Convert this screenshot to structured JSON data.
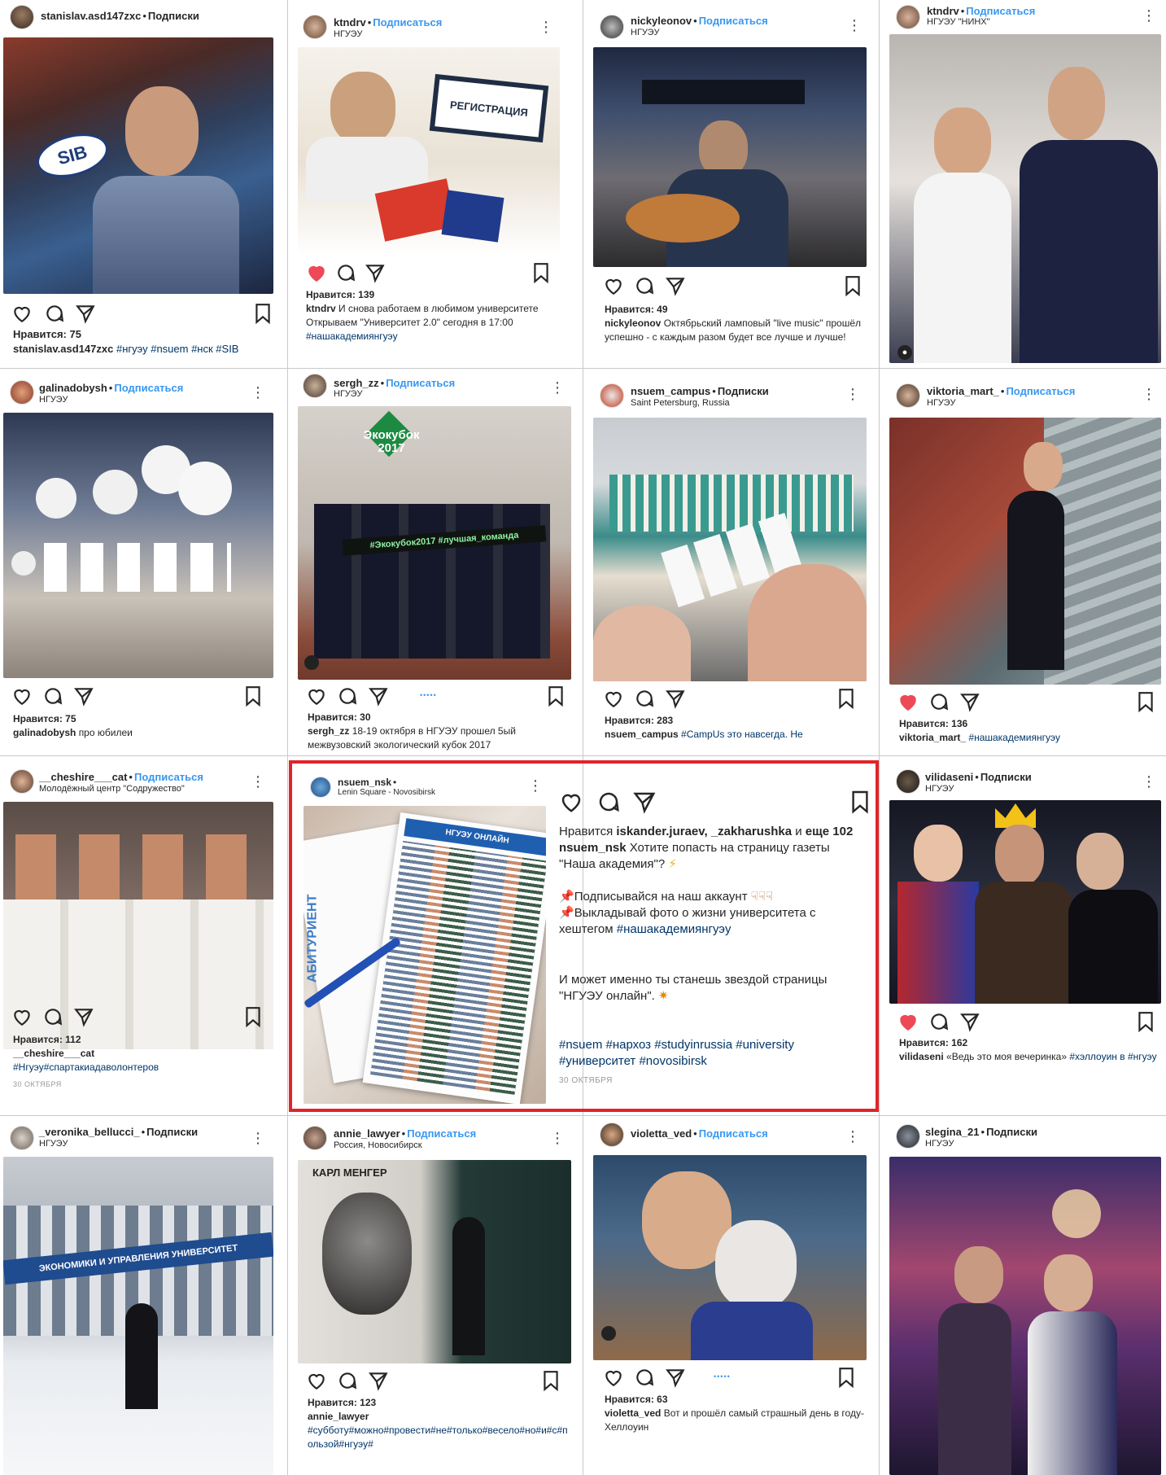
{
  "colors": {
    "accent": "#3897f0",
    "like_red": "#ed4956",
    "highlight_border": "#e0242a",
    "hashtag": "#003569"
  },
  "icons": [
    "heart-icon",
    "comment-icon",
    "share-icon",
    "bookmark-icon",
    "more-icon",
    "user-tag-icon"
  ],
  "posts": [
    {
      "user": "stanislav.asd147zxc",
      "sep": "•",
      "status": "Подписки",
      "location": "",
      "likes": "Нравится: 75",
      "caption_user": "stanislav.asd147zxc",
      "caption": "#нгуэу #nsuem #нск #SIB",
      "liked": false
    },
    {
      "user": "ktndrv",
      "sep": "•",
      "status": "Подписаться",
      "location": "НГУЭУ",
      "likes": "Нравится: 139",
      "caption_user": "ktndrv",
      "caption": "И снова работаем в любимом университете",
      "caption2": "Открываем \"Университет 2.0\" сегодня в 17:00",
      "caption3": "#нашакадемиянгуэу",
      "liked": true
    },
    {
      "user": "nickyleonov",
      "sep": "•",
      "status": "Подписаться",
      "location": "НГУЭУ",
      "likes": "Нравится: 49",
      "caption_user": "nickyleonov",
      "caption": "Октябрьский ламповый \"live music\" прошёл успешно - с каждым разом будет все лучше и лучше!",
      "liked": false
    },
    {
      "user": "ktndrv",
      "sep": "•",
      "status": "Подписаться",
      "location": "НГУЭУ \"НИНХ\"",
      "liked": false
    },
    {
      "user": "galinadobysh",
      "sep": "•",
      "status": "Подписаться",
      "location": "НГУЭУ",
      "likes": "Нравится: 75",
      "caption_user": "galinadobysh",
      "caption": "про юбилеи",
      "liked": false
    },
    {
      "user": "sergh_zz",
      "sep": "•",
      "status": "Подписаться",
      "location": "НГУЭУ",
      "likes": "Нравится: 30",
      "caption_user": "sergh_zz",
      "caption": "18-19 октября в НГУЭУ прошел 5ый межвузовский экологический кубок 2017",
      "dots": "•••••",
      "liked": false
    },
    {
      "user": "nsuem_campus",
      "sep": "•",
      "status": "Подписки",
      "location": "Saint Petersburg, Russia",
      "likes": "Нравится: 283",
      "caption_user": "nsuem_campus",
      "caption": "#CampUs это навсегда. Не",
      "liked": false
    },
    {
      "user": "viktoria_mart_",
      "sep": "•",
      "status": "Подписаться",
      "location": "НГУЭУ",
      "likes": "Нравится: 136",
      "caption_user": "viktoria_mart_",
      "caption": "#нашакадемиянгуэу",
      "liked": true
    },
    {
      "user": "__cheshire___cat",
      "sep": "•",
      "status": "Подписаться",
      "location": "Молодёжный центр \"Содружество\"",
      "likes": "Нравится: 112",
      "caption_user": "__cheshire___cat",
      "caption": "#Нгуэу#спартакиадаволонтеров",
      "date": "30 ОКТЯБРЯ",
      "liked": false
    },
    {
      "user": "vilidaseni",
      "sep": "•",
      "status": "Подписки",
      "location": "НГУЭУ",
      "likes": "Нравится: 162",
      "caption_user": "vilidaseni",
      "caption": "«Ведь это моя вечеринка»",
      "caption3": "#хэллоуин в #нгуэу",
      "liked": true
    },
    {
      "user": "_veronika_bellucci_",
      "sep": "•",
      "status": "Подписки",
      "location": "НГУЭУ",
      "liked": false
    },
    {
      "user": "annie_lawyer",
      "sep": "•",
      "status": "Подписаться",
      "location": "Россия, Новосибирск",
      "likes": "Нравится: 123",
      "caption_user": "annie_lawyer",
      "caption": "#субботу#можно#провести#не#только#весело#но#и#с#пользой#нгуэу#",
      "liked": false
    },
    {
      "user": "violetta_ved",
      "sep": "•",
      "status": "Подписаться",
      "location": "",
      "likes": "Нравится: 63",
      "caption_user": "violetta_ved",
      "caption": "Вот и прошёл самый страшный день в году- Хеллоуин",
      "dots": "•••••",
      "liked": false
    },
    {
      "user": "slegina_21",
      "sep": "•",
      "status": "Подписки",
      "location": "НГУЭУ",
      "liked": false
    }
  ],
  "feature": {
    "user": "nsuem_nsk",
    "sep": "•",
    "location": "Lenin Square - Novosibirsk",
    "likes_prefix": "Нравится",
    "likes_users": "iskander.juraev, _zakharushka",
    "likes_and": "и",
    "likes_more": "еще 102",
    "caption_user": "nsuem_nsk",
    "caption_line1": "Хотите попасть на страницу газеты \"Наша академия\"?",
    "bullet1": "Подписывайся на наш аккаунт",
    "bullet2": "Выкладывай фото о жизни университета с хештегом",
    "bullet2_tag": "#нашакадемиянгуэу",
    "line3": "И может именно ты станешь звездой страницы \"НГУЭУ онлайн\".",
    "tags_line1": "#nsuem #нархоз #studyinrussia #university",
    "tags_line2": "#университет #novosibirsk",
    "date": "30 ОКТЯБРЯ",
    "photo_text_1": "АБИТУРИЕНТ",
    "photo_text_2": "НГУЭУ ОНЛАЙН"
  },
  "photo_texts": {
    "p1_sign": "SIB",
    "p2_sign": "РЕГИСТРАЦИЯ",
    "p6_banner": "#Экокубок2017 #лучшая_команда",
    "p6_balloon": "Экокубок 2017",
    "p11_sign": "ЭКОНОМИКИ И УПРАВЛЕНИЯ  УНИВЕРСИТЕТ",
    "p12_sign": "КАРЛ МЕНГЕР"
  }
}
